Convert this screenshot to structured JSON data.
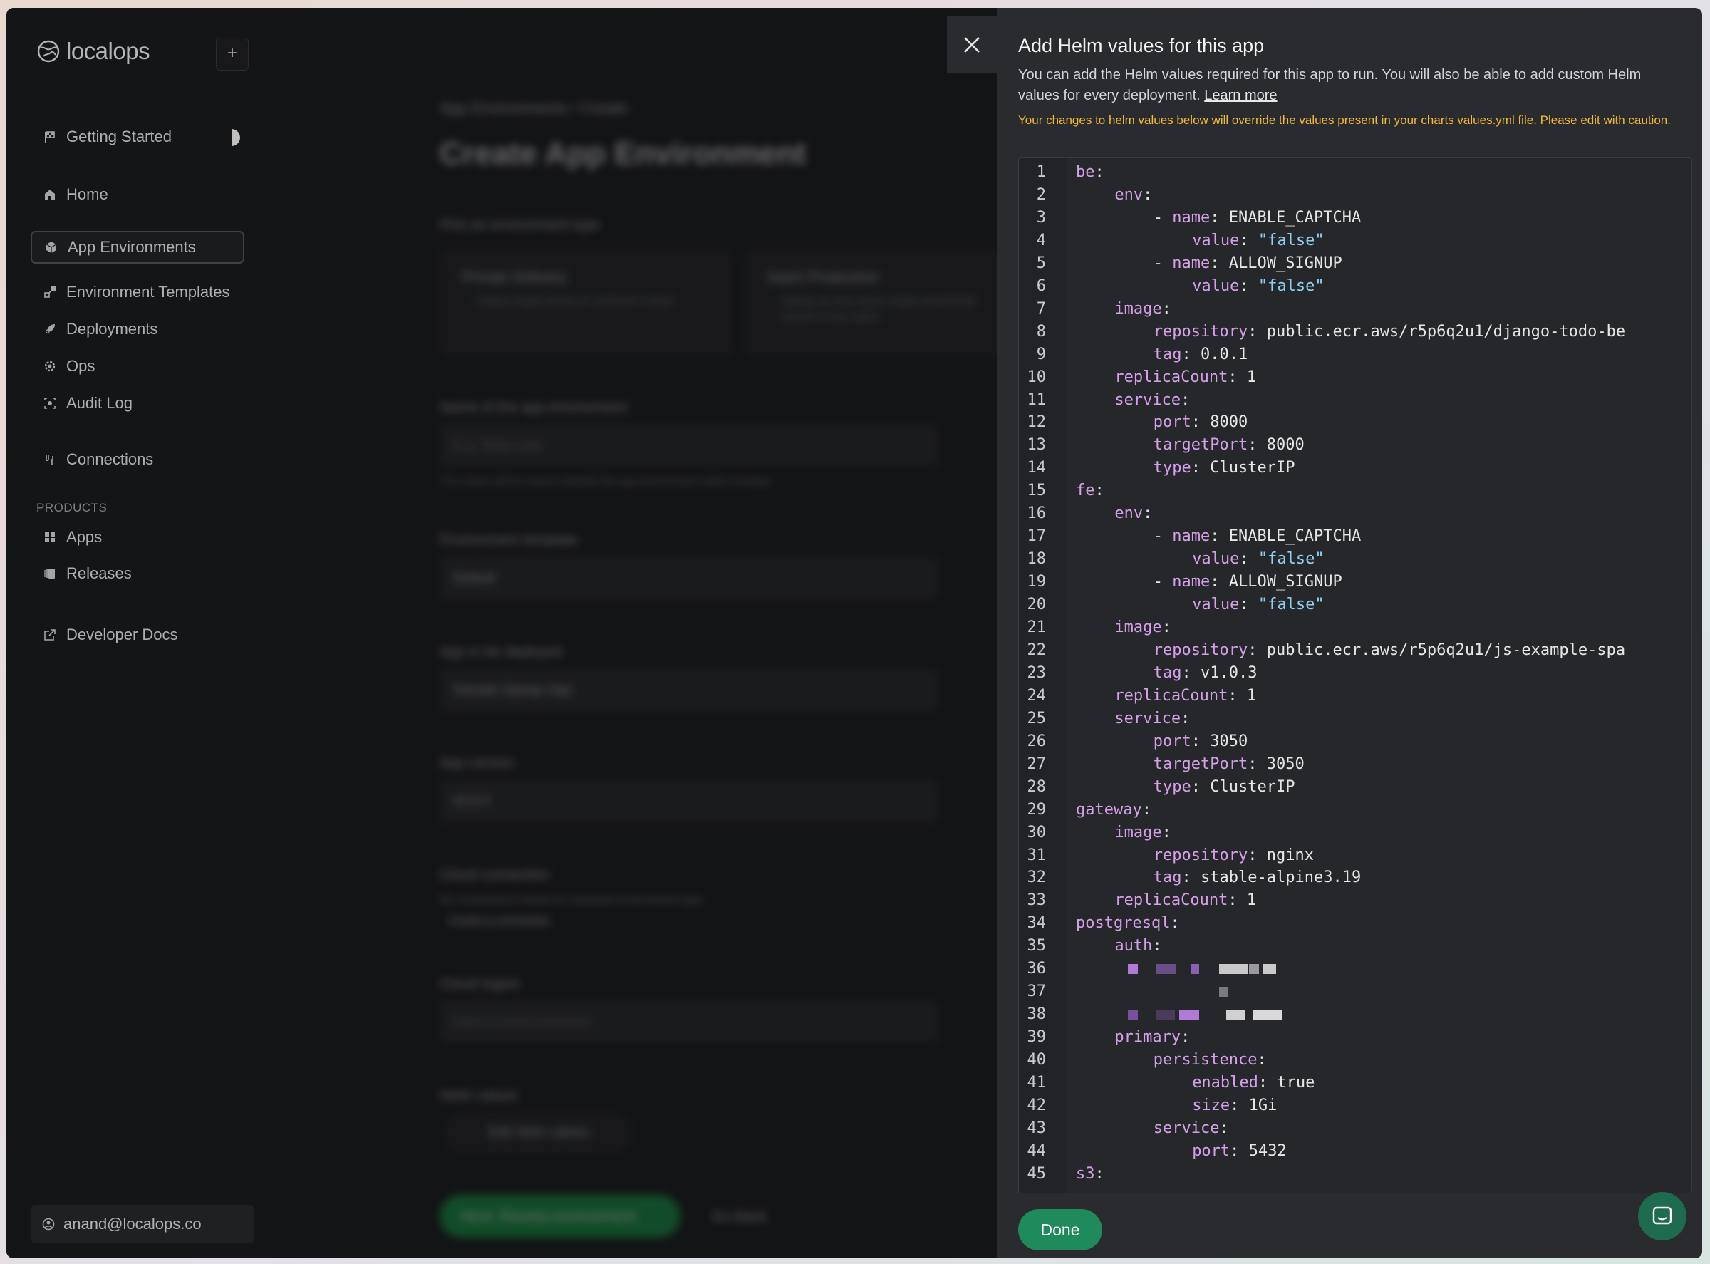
{
  "brand": {
    "name": "localops"
  },
  "sidebar": {
    "getting_started": "Getting Started",
    "items": [
      {
        "label": "Home",
        "icon": "home-icon"
      },
      {
        "label": "App Environments",
        "icon": "cube-icon",
        "active": true
      },
      {
        "label": "Environment Templates",
        "icon": "template-icon"
      },
      {
        "label": "Deployments",
        "icon": "rocket-icon"
      },
      {
        "label": "Ops",
        "icon": "gear-icon"
      },
      {
        "label": "Audit Log",
        "icon": "audit-icon"
      }
    ],
    "connections": "Connections",
    "products_label": "PRODUCTS",
    "products": [
      {
        "label": "Apps",
        "icon": "grid-icon"
      },
      {
        "label": "Releases",
        "icon": "releases-icon"
      }
    ],
    "docs": "Developer Docs",
    "user": "anand@localops.co"
  },
  "main": {
    "breadcrumb": "App Environments / Create",
    "title": "Create App Environment",
    "env_type_label": "Pick an environment type",
    "card1_title": "Private Delivery",
    "card1_desc": "Deploy single tenant on customer's cloud",
    "card2_title": "SaaS Production",
    "card2_desc": "Deploy on your cloud, single tenant/multi tenant on any region",
    "name_label": "Name of the app environment",
    "name_placeholder": "E.g. Tesla corp",
    "name_help": "This name will be used to identify this app environment within localops",
    "template_label": "Environment template",
    "template_value": "Default",
    "app_label": "App to be deployed",
    "app_value": "Sample Django App",
    "version_label": "App version",
    "version_value": "v0.0.0",
    "cloud_label": "Cloud connection",
    "cloud_help": "No connections found for selected environment type.",
    "cloud_link": "Create a connection",
    "region_label": "Cloud region",
    "region_value": "Select a cloud connection",
    "helm_label": "Helm values",
    "helm_btn": "Edit Helm values",
    "next_btn": "Next: Review environment",
    "back_btn": "Go Back"
  },
  "drawer": {
    "title": "Add Helm values for this app",
    "description": "You can add the Helm values required for this app to run. You will also be able to add custom Helm values for every deployment.",
    "learn_more": "Learn more",
    "warning": "Your changes to helm values below will override the values present in your charts values.yml file. Please edit with caution.",
    "done": "Done",
    "code": [
      {
        "n": "1",
        "i": 0,
        "k": "be",
        "v": ""
      },
      {
        "n": "2",
        "i": 1,
        "k": "env",
        "v": ""
      },
      {
        "n": "3",
        "i": 2,
        "d": true,
        "k": "name",
        "v": "ENABLE_CAPTCHA"
      },
      {
        "n": "4",
        "i": 3,
        "k": "value",
        "v": "\"false\"",
        "s": true
      },
      {
        "n": "5",
        "i": 2,
        "d": true,
        "k": "name",
        "v": "ALLOW_SIGNUP"
      },
      {
        "n": "6",
        "i": 3,
        "k": "value",
        "v": "\"false\"",
        "s": true
      },
      {
        "n": "7",
        "i": 1,
        "k": "image",
        "v": ""
      },
      {
        "n": "8",
        "i": 2,
        "k": "repository",
        "v": "public.ecr.aws/r5p6q2u1/django-todo-be"
      },
      {
        "n": "9",
        "i": 2,
        "k": "tag",
        "v": "0.0.1"
      },
      {
        "n": "10",
        "i": 1,
        "k": "replicaCount",
        "v": "1"
      },
      {
        "n": "11",
        "i": 1,
        "k": "service",
        "v": ""
      },
      {
        "n": "12",
        "i": 2,
        "k": "port",
        "v": "8000"
      },
      {
        "n": "13",
        "i": 2,
        "k": "targetPort",
        "v": "8000"
      },
      {
        "n": "14",
        "i": 2,
        "k": "type",
        "v": "ClusterIP"
      },
      {
        "n": "15",
        "i": 0,
        "k": "fe",
        "v": ""
      },
      {
        "n": "16",
        "i": 1,
        "k": "env",
        "v": ""
      },
      {
        "n": "17",
        "i": 2,
        "d": true,
        "k": "name",
        "v": "ENABLE_CAPTCHA"
      },
      {
        "n": "18",
        "i": 3,
        "k": "value",
        "v": "\"false\"",
        "s": true
      },
      {
        "n": "19",
        "i": 2,
        "d": true,
        "k": "name",
        "v": "ALLOW_SIGNUP"
      },
      {
        "n": "20",
        "i": 3,
        "k": "value",
        "v": "\"false\"",
        "s": true
      },
      {
        "n": "21",
        "i": 1,
        "k": "image",
        "v": ""
      },
      {
        "n": "22",
        "i": 2,
        "k": "repository",
        "v": "public.ecr.aws/r5p6q2u1/js-example-spa"
      },
      {
        "n": "23",
        "i": 2,
        "k": "tag",
        "v": "v1.0.3"
      },
      {
        "n": "24",
        "i": 1,
        "k": "replicaCount",
        "v": "1"
      },
      {
        "n": "25",
        "i": 1,
        "k": "service",
        "v": ""
      },
      {
        "n": "26",
        "i": 2,
        "k": "port",
        "v": "3050"
      },
      {
        "n": "27",
        "i": 2,
        "k": "targetPort",
        "v": "3050"
      },
      {
        "n": "28",
        "i": 2,
        "k": "type",
        "v": "ClusterIP"
      },
      {
        "n": "29",
        "i": 0,
        "k": "gateway",
        "v": ""
      },
      {
        "n": "30",
        "i": 1,
        "k": "image",
        "v": ""
      },
      {
        "n": "31",
        "i": 2,
        "k": "repository",
        "v": "nginx"
      },
      {
        "n": "32",
        "i": 2,
        "k": "tag",
        "v": "stable-alpine3.19"
      },
      {
        "n": "33",
        "i": 1,
        "k": "replicaCount",
        "v": "1"
      },
      {
        "n": "34",
        "i": 0,
        "k": "postgresql",
        "v": ""
      },
      {
        "n": "35",
        "i": 1,
        "k": "auth",
        "v": ""
      },
      {
        "n": "36",
        "redacted": true
      },
      {
        "n": "37",
        "redacted": true
      },
      {
        "n": "38",
        "redacted": true
      },
      {
        "n": "39",
        "i": 1,
        "k": "primary",
        "v": ""
      },
      {
        "n": "40",
        "i": 2,
        "k": "persistence",
        "v": ""
      },
      {
        "n": "41",
        "i": 3,
        "k": "enabled",
        "v": "true"
      },
      {
        "n": "42",
        "i": 3,
        "k": "size",
        "v": "1Gi"
      },
      {
        "n": "43",
        "i": 2,
        "k": "service",
        "v": ""
      },
      {
        "n": "44",
        "i": 3,
        "k": "port",
        "v": "5432"
      },
      {
        "n": "45",
        "i": 0,
        "k": "s3",
        "v": ""
      }
    ]
  },
  "colors": {
    "accent_green": "#1f8a5b",
    "warning": "#f2b93b",
    "yaml_key": "#d4a0e8",
    "yaml_string": "#8ed0f2"
  }
}
